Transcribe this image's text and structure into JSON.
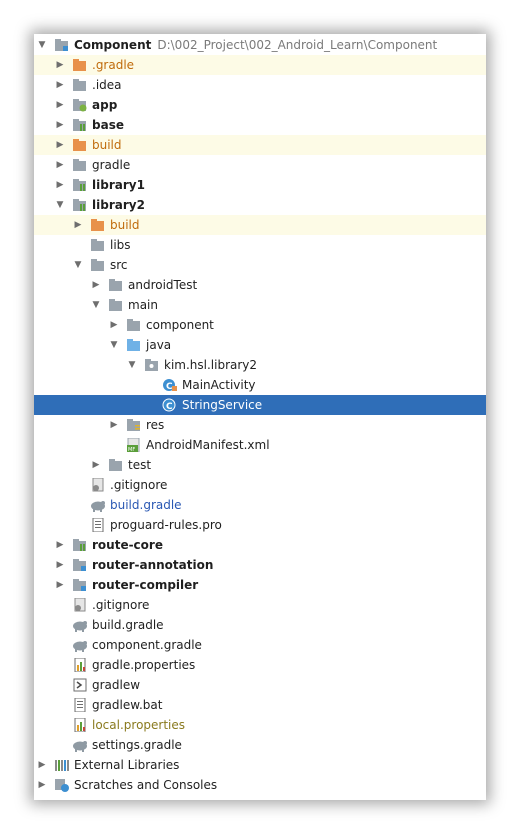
{
  "tree": {
    "root": {
      "name": "Component",
      "path": "D:\\002_Project\\002_Android_Learn\\Component"
    },
    "rows": [
      {
        "label": ".gradle"
      },
      {
        "label": ".idea"
      },
      {
        "label": "app"
      },
      {
        "label": "base"
      },
      {
        "label": "build"
      },
      {
        "label": "gradle"
      },
      {
        "label": "library1"
      },
      {
        "label": "library2"
      },
      {
        "label": "build"
      },
      {
        "label": "libs"
      },
      {
        "label": "src"
      },
      {
        "label": "androidTest"
      },
      {
        "label": "main"
      },
      {
        "label": "component"
      },
      {
        "label": "java"
      },
      {
        "label": "kim.hsl.library2"
      },
      {
        "label": "MainActivity"
      },
      {
        "label": "StringService"
      },
      {
        "label": "res"
      },
      {
        "label": "AndroidManifest.xml"
      },
      {
        "label": "test"
      },
      {
        "label": ".gitignore"
      },
      {
        "label": "build.gradle"
      },
      {
        "label": "proguard-rules.pro"
      },
      {
        "label": "route-core"
      },
      {
        "label": "router-annotation"
      },
      {
        "label": "router-compiler"
      },
      {
        "label": ".gitignore"
      },
      {
        "label": "build.gradle"
      },
      {
        "label": "component.gradle"
      },
      {
        "label": "gradle.properties"
      },
      {
        "label": "gradlew"
      },
      {
        "label": "gradlew.bat"
      },
      {
        "label": "local.properties"
      },
      {
        "label": "settings.gradle"
      },
      {
        "label": "External Libraries"
      },
      {
        "label": "Scratches and Consoles"
      }
    ]
  },
  "colors": {
    "selection": "#2f6eb8",
    "excluded_highlight": "#fdfbe6",
    "folder": "#9aa4ad",
    "excluded_folder": "#e8914a"
  }
}
